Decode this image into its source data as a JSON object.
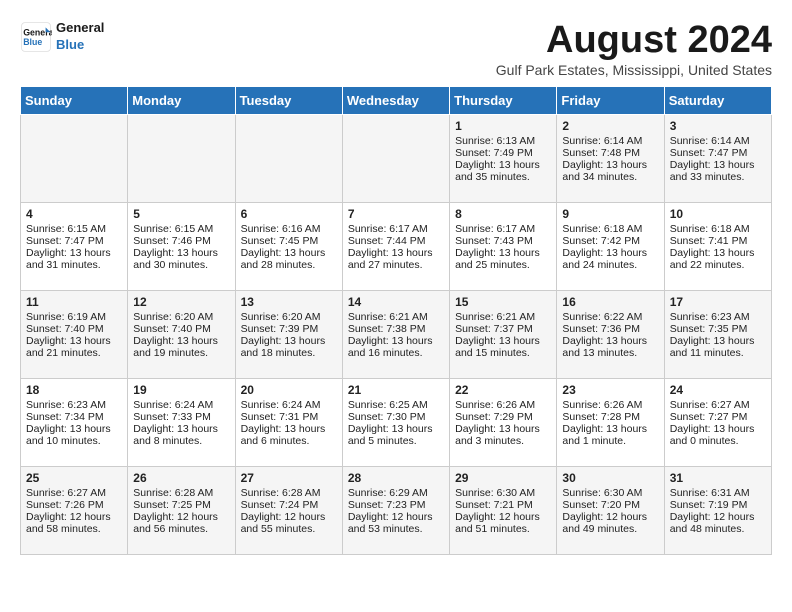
{
  "header": {
    "logo_line1": "General",
    "logo_line2": "Blue",
    "month_title": "August 2024",
    "location": "Gulf Park Estates, Mississippi, United States"
  },
  "days_of_week": [
    "Sunday",
    "Monday",
    "Tuesday",
    "Wednesday",
    "Thursday",
    "Friday",
    "Saturday"
  ],
  "weeks": [
    {
      "days": [
        {
          "number": "",
          "content": ""
        },
        {
          "number": "",
          "content": ""
        },
        {
          "number": "",
          "content": ""
        },
        {
          "number": "",
          "content": ""
        },
        {
          "number": "1",
          "content": "Sunrise: 6:13 AM\nSunset: 7:49 PM\nDaylight: 13 hours\nand 35 minutes."
        },
        {
          "number": "2",
          "content": "Sunrise: 6:14 AM\nSunset: 7:48 PM\nDaylight: 13 hours\nand 34 minutes."
        },
        {
          "number": "3",
          "content": "Sunrise: 6:14 AM\nSunset: 7:47 PM\nDaylight: 13 hours\nand 33 minutes."
        }
      ]
    },
    {
      "days": [
        {
          "number": "4",
          "content": "Sunrise: 6:15 AM\nSunset: 7:47 PM\nDaylight: 13 hours\nand 31 minutes."
        },
        {
          "number": "5",
          "content": "Sunrise: 6:15 AM\nSunset: 7:46 PM\nDaylight: 13 hours\nand 30 minutes."
        },
        {
          "number": "6",
          "content": "Sunrise: 6:16 AM\nSunset: 7:45 PM\nDaylight: 13 hours\nand 28 minutes."
        },
        {
          "number": "7",
          "content": "Sunrise: 6:17 AM\nSunset: 7:44 PM\nDaylight: 13 hours\nand 27 minutes."
        },
        {
          "number": "8",
          "content": "Sunrise: 6:17 AM\nSunset: 7:43 PM\nDaylight: 13 hours\nand 25 minutes."
        },
        {
          "number": "9",
          "content": "Sunrise: 6:18 AM\nSunset: 7:42 PM\nDaylight: 13 hours\nand 24 minutes."
        },
        {
          "number": "10",
          "content": "Sunrise: 6:18 AM\nSunset: 7:41 PM\nDaylight: 13 hours\nand 22 minutes."
        }
      ]
    },
    {
      "days": [
        {
          "number": "11",
          "content": "Sunrise: 6:19 AM\nSunset: 7:40 PM\nDaylight: 13 hours\nand 21 minutes."
        },
        {
          "number": "12",
          "content": "Sunrise: 6:20 AM\nSunset: 7:40 PM\nDaylight: 13 hours\nand 19 minutes."
        },
        {
          "number": "13",
          "content": "Sunrise: 6:20 AM\nSunset: 7:39 PM\nDaylight: 13 hours\nand 18 minutes."
        },
        {
          "number": "14",
          "content": "Sunrise: 6:21 AM\nSunset: 7:38 PM\nDaylight: 13 hours\nand 16 minutes."
        },
        {
          "number": "15",
          "content": "Sunrise: 6:21 AM\nSunset: 7:37 PM\nDaylight: 13 hours\nand 15 minutes."
        },
        {
          "number": "16",
          "content": "Sunrise: 6:22 AM\nSunset: 7:36 PM\nDaylight: 13 hours\nand 13 minutes."
        },
        {
          "number": "17",
          "content": "Sunrise: 6:23 AM\nSunset: 7:35 PM\nDaylight: 13 hours\nand 11 minutes."
        }
      ]
    },
    {
      "days": [
        {
          "number": "18",
          "content": "Sunrise: 6:23 AM\nSunset: 7:34 PM\nDaylight: 13 hours\nand 10 minutes."
        },
        {
          "number": "19",
          "content": "Sunrise: 6:24 AM\nSunset: 7:33 PM\nDaylight: 13 hours\nand 8 minutes."
        },
        {
          "number": "20",
          "content": "Sunrise: 6:24 AM\nSunset: 7:31 PM\nDaylight: 13 hours\nand 6 minutes."
        },
        {
          "number": "21",
          "content": "Sunrise: 6:25 AM\nSunset: 7:30 PM\nDaylight: 13 hours\nand 5 minutes."
        },
        {
          "number": "22",
          "content": "Sunrise: 6:26 AM\nSunset: 7:29 PM\nDaylight: 13 hours\nand 3 minutes."
        },
        {
          "number": "23",
          "content": "Sunrise: 6:26 AM\nSunset: 7:28 PM\nDaylight: 13 hours\nand 1 minute."
        },
        {
          "number": "24",
          "content": "Sunrise: 6:27 AM\nSunset: 7:27 PM\nDaylight: 13 hours\nand 0 minutes."
        }
      ]
    },
    {
      "days": [
        {
          "number": "25",
          "content": "Sunrise: 6:27 AM\nSunset: 7:26 PM\nDaylight: 12 hours\nand 58 minutes."
        },
        {
          "number": "26",
          "content": "Sunrise: 6:28 AM\nSunset: 7:25 PM\nDaylight: 12 hours\nand 56 minutes."
        },
        {
          "number": "27",
          "content": "Sunrise: 6:28 AM\nSunset: 7:24 PM\nDaylight: 12 hours\nand 55 minutes."
        },
        {
          "number": "28",
          "content": "Sunrise: 6:29 AM\nSunset: 7:23 PM\nDaylight: 12 hours\nand 53 minutes."
        },
        {
          "number": "29",
          "content": "Sunrise: 6:30 AM\nSunset: 7:21 PM\nDaylight: 12 hours\nand 51 minutes."
        },
        {
          "number": "30",
          "content": "Sunrise: 6:30 AM\nSunset: 7:20 PM\nDaylight: 12 hours\nand 49 minutes."
        },
        {
          "number": "31",
          "content": "Sunrise: 6:31 AM\nSunset: 7:19 PM\nDaylight: 12 hours\nand 48 minutes."
        }
      ]
    }
  ]
}
